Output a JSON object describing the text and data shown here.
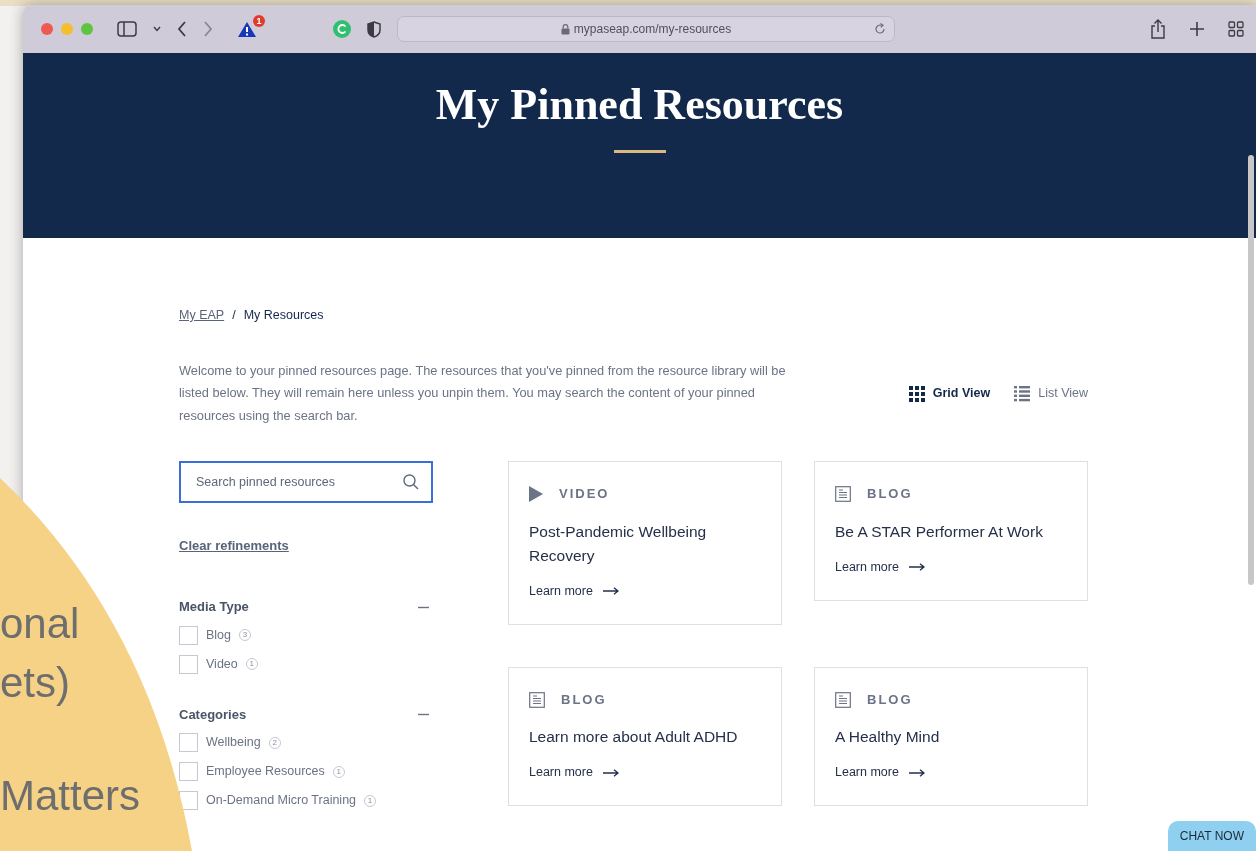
{
  "browser": {
    "alert_badge": "1",
    "url": "mypaseap.com/my-resources"
  },
  "hero": {
    "title": "My Pinned Resources"
  },
  "breadcrumb": [
    {
      "label": "My EAP",
      "link": true
    },
    {
      "label": "My Resources",
      "link": false
    }
  ],
  "breadcrumb_separator": "/",
  "intro": "Welcome to your pinned resources page. The resources that you've pinned from the resource library will be listed below. They will remain here unless you unpin them. You may search the content of your pinned resources using the search bar.",
  "views": [
    {
      "kind": "grid",
      "label": "Grid View",
      "selected": true
    },
    {
      "kind": "list",
      "label": "List View",
      "selected": false
    }
  ],
  "search": {
    "placeholder": "Search pinned resources"
  },
  "clear_link": "Clear refinements",
  "filters": [
    {
      "title": "Media Type",
      "expanded": true,
      "options": [
        {
          "label": "Blog",
          "count": "3",
          "checked": false
        },
        {
          "label": "Video",
          "count": "1",
          "checked": false
        }
      ]
    },
    {
      "title": "Categories",
      "expanded": true,
      "options": [
        {
          "label": "Wellbeing",
          "count": "2",
          "checked": false
        },
        {
          "label": "Employee Resources",
          "count": "1",
          "checked": false
        },
        {
          "label": "On-Demand Micro Training",
          "count": "1",
          "checked": false
        }
      ]
    }
  ],
  "cards": [
    {
      "kind": "video",
      "type_label": "VIDEO",
      "title": "Post-Pandemic Wellbeing Recovery",
      "link": "Learn more"
    },
    {
      "kind": "blog",
      "type_label": "BLOG",
      "title": "Be A STAR Performer At Work",
      "link": "Learn more"
    },
    {
      "kind": "blog",
      "type_label": "BLOG",
      "title": "Learn more about Adult ADHD",
      "link": "Learn more"
    },
    {
      "kind": "blog",
      "type_label": "BLOG",
      "title": "A Healthy Mind",
      "link": "Learn more"
    }
  ],
  "chat_button": "CHAT NOW",
  "background_texts": [
    "onal",
    "ets)",
    "Matters"
  ]
}
